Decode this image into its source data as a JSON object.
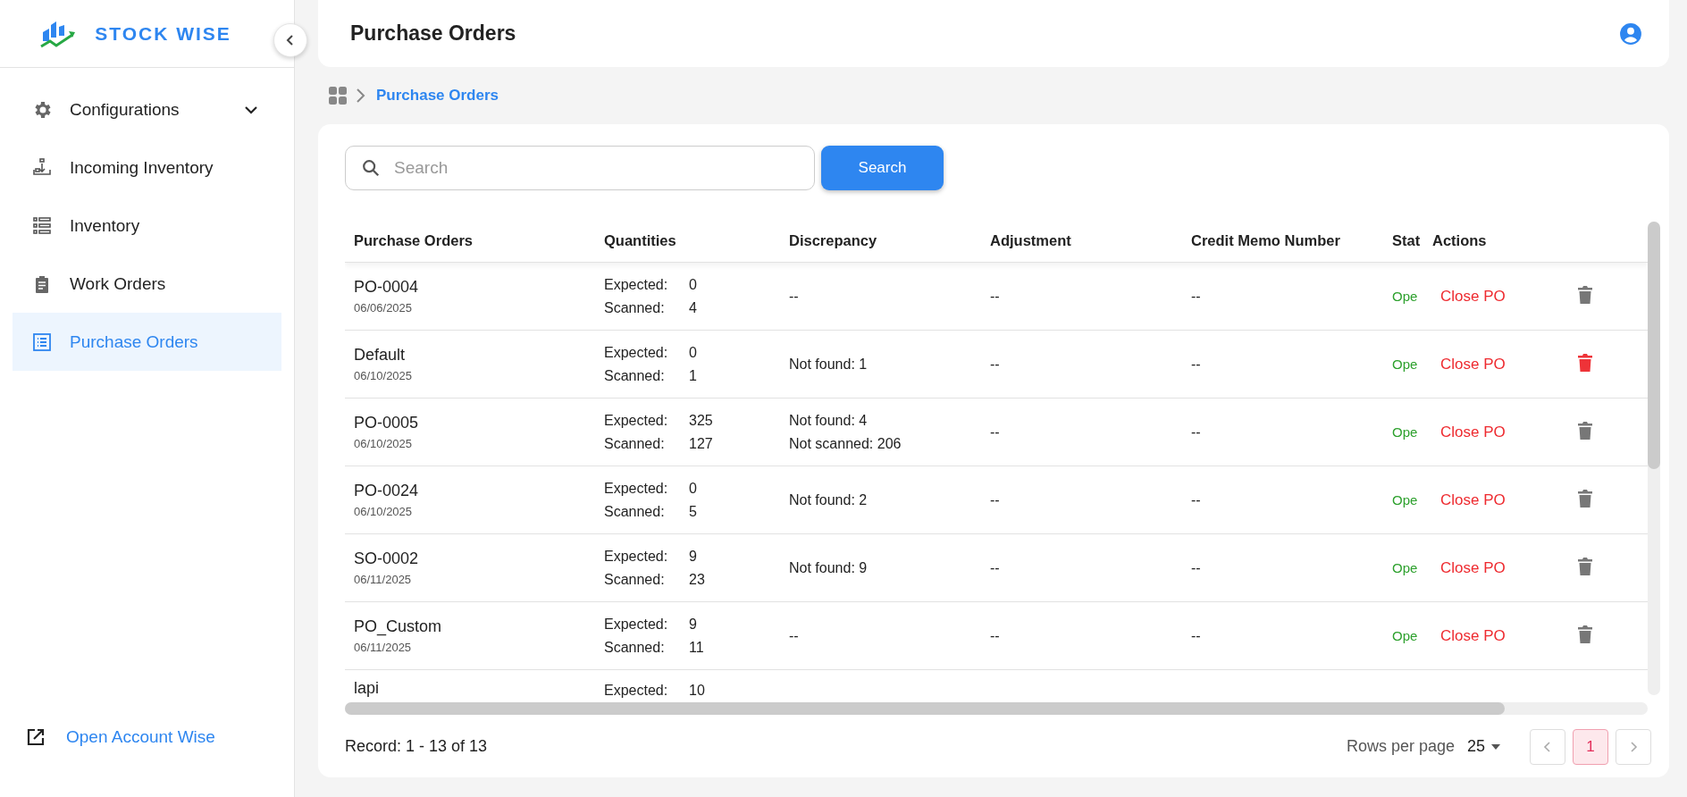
{
  "sidebar": {
    "logo": "STOCK WISE",
    "items": [
      {
        "label": "Configurations",
        "selected": false,
        "expanded": false
      },
      {
        "label": "Incoming Inventory",
        "selected": false
      },
      {
        "label": "Inventory",
        "selected": false
      },
      {
        "label": "Work Orders",
        "selected": false
      },
      {
        "label": "Purchase Orders",
        "selected": true
      }
    ],
    "footer_link": "Open Account Wise"
  },
  "header": {
    "title": "Purchase Orders"
  },
  "breadcrumb": {
    "current": "Purchase Orders"
  },
  "search": {
    "placeholder": "Search",
    "button": "Search"
  },
  "table": {
    "columns": [
      "Purchase Orders",
      "Quantities",
      "Discrepancy",
      "Adjustment",
      "Credit Memo Number",
      "Stat",
      "Actions"
    ],
    "rows": [
      {
        "name": "PO-0004",
        "date": "06/06/2025",
        "quantities": [
          {
            "label": "Expected:",
            "value": "0"
          },
          {
            "label": "Scanned:",
            "value": "4"
          }
        ],
        "discrepancy": [
          "--"
        ],
        "adjustment": "--",
        "credit_memo": "--",
        "status": "Ope",
        "action": "Close PO",
        "delete_highlighted": false
      },
      {
        "name": "Default",
        "date": "06/10/2025",
        "quantities": [
          {
            "label": "Expected:",
            "value": "0"
          },
          {
            "label": "Scanned:",
            "value": "1"
          }
        ],
        "discrepancy": [
          "Not found: 1"
        ],
        "adjustment": "--",
        "credit_memo": "--",
        "status": "Ope",
        "action": "Close PO",
        "delete_highlighted": true
      },
      {
        "name": "PO-0005",
        "date": "06/10/2025",
        "quantities": [
          {
            "label": "Expected:",
            "value": "325"
          },
          {
            "label": "Scanned:",
            "value": "127"
          }
        ],
        "discrepancy": [
          "Not found: 4",
          "Not scanned: 206"
        ],
        "adjustment": "--",
        "credit_memo": "--",
        "status": "Ope",
        "action": "Close PO",
        "delete_highlighted": false
      },
      {
        "name": "PO-0024",
        "date": "06/10/2025",
        "quantities": [
          {
            "label": "Expected:",
            "value": "0"
          },
          {
            "label": "Scanned:",
            "value": "5"
          }
        ],
        "discrepancy": [
          "Not found: 2"
        ],
        "adjustment": "--",
        "credit_memo": "--",
        "status": "Ope",
        "action": "Close PO",
        "delete_highlighted": false
      },
      {
        "name": "SO-0002",
        "date": "06/11/2025",
        "quantities": [
          {
            "label": "Expected:",
            "value": "9"
          },
          {
            "label": "Scanned:",
            "value": "23"
          }
        ],
        "discrepancy": [
          "Not found: 9"
        ],
        "adjustment": "--",
        "credit_memo": "--",
        "status": "Ope",
        "action": "Close PO",
        "delete_highlighted": false
      },
      {
        "name": "PO_Custom",
        "date": "06/11/2025",
        "quantities": [
          {
            "label": "Expected:",
            "value": "9"
          },
          {
            "label": "Scanned:",
            "value": "11"
          }
        ],
        "discrepancy": [
          "--"
        ],
        "adjustment": "--",
        "credit_memo": "--",
        "status": "Ope",
        "action": "Close PO",
        "delete_highlighted": false
      },
      {
        "name": "lapi",
        "quantities": [
          {
            "label": "Expected:",
            "value": "10"
          }
        ]
      }
    ]
  },
  "footer": {
    "record": "Record: 1 - 13 of 13",
    "rows_per_page_label": "Rows per page",
    "rows_per_page": "25",
    "pages": [
      {
        "label": "1",
        "selected": true
      }
    ]
  }
}
